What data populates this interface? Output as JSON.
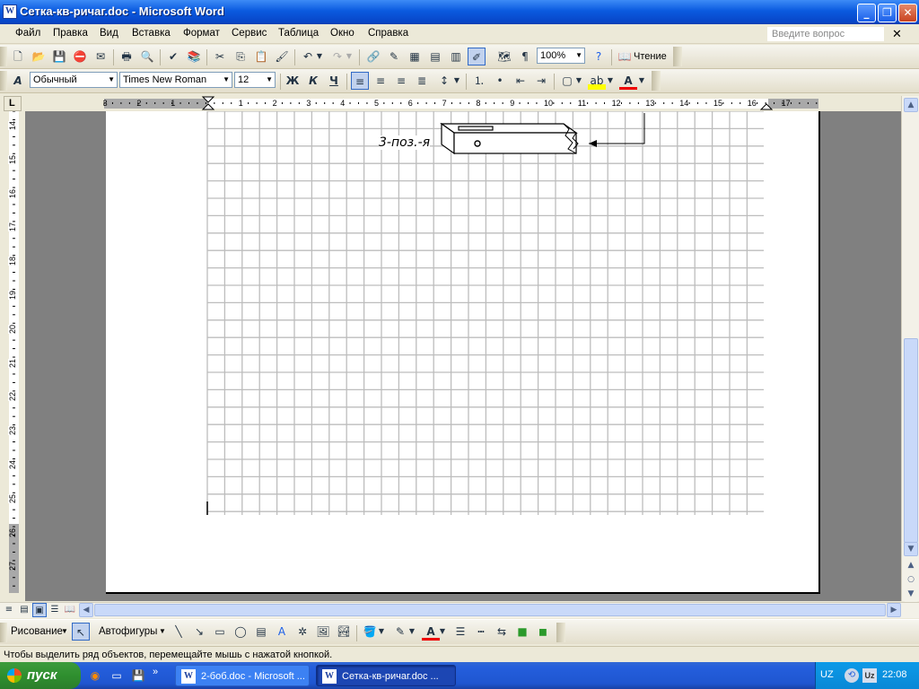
{
  "window": {
    "title": "Сетка-кв-ричаг.doc - Microsoft Word",
    "icon": "word-doc-icon"
  },
  "menu": [
    "Файл",
    "Правка",
    "Вид",
    "Вставка",
    "Формат",
    "Сервис",
    "Таблица",
    "Окно",
    "Справка"
  ],
  "help_placeholder": "Введите вопрос",
  "toolbar1": {
    "zoom": "100%",
    "reading_label": "Чтение"
  },
  "toolbar2": {
    "style": "Обычный",
    "font": "Times New Roman",
    "size": "12",
    "bold": "Ж",
    "italic": "К",
    "underline": "Ч"
  },
  "hruler_labels": [
    "3",
    "2",
    "1",
    "1",
    "2",
    "3",
    "4",
    "5",
    "6",
    "7",
    "8",
    "9",
    "10",
    "11",
    "12",
    "13",
    "14",
    "15",
    "16",
    "17"
  ],
  "vruler_labels": [
    "14",
    "15",
    "16",
    "17",
    "18",
    "19",
    "20",
    "21",
    "22",
    "23",
    "24",
    "25",
    "26",
    "27"
  ],
  "document": {
    "label": "3-поз.-я"
  },
  "drawing": {
    "draw_label": "Рисование",
    "autoshapes_label": "Автофигуры"
  },
  "status": "Чтобы выделить ряд объектов, перемещайте мышь с нажатой кнопкой.",
  "taskbar": {
    "start_label": "пуск",
    "tasks": [
      {
        "label": "2-боб.doc - Microsoft ..."
      },
      {
        "label": "Сетка-кв-ричаг.doc ..."
      }
    ],
    "lang": "UZ",
    "time": "22:08"
  },
  "colors": {
    "titlebar": "#0a5adf",
    "taskbar": "#245edc",
    "start": "#2f8f2f",
    "grid": "#bdbdbd",
    "workspace": "#808080"
  }
}
